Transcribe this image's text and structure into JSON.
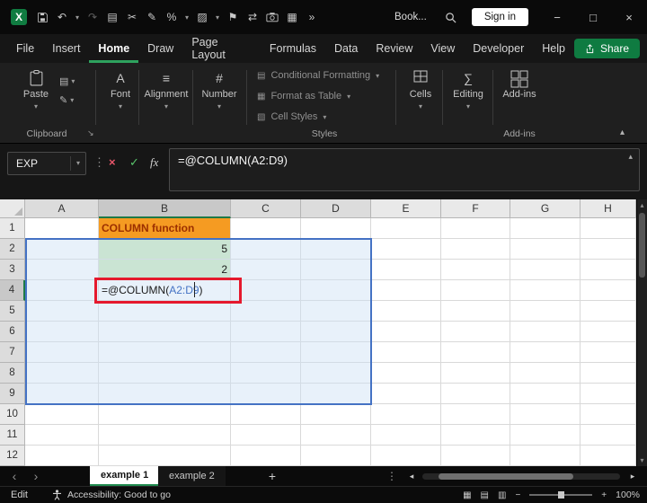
{
  "titlebar": {
    "workbook_name": "Book...",
    "sign_in_label": "Sign in"
  },
  "menubar": {
    "items": [
      "File",
      "Insert",
      "Home",
      "Draw",
      "Page Layout",
      "Formulas",
      "Data",
      "Review",
      "View",
      "Developer",
      "Help"
    ],
    "active_item": "Home",
    "share_label": "Share"
  },
  "ribbon": {
    "paste_label": "Paste",
    "clipboard_group_label": "Clipboard",
    "font_label": "Font",
    "alignment_label": "Alignment",
    "number_label": "Number",
    "conditional_formatting_label": "Conditional Formatting",
    "format_as_table_label": "Format as Table",
    "cell_styles_label": "Cell Styles",
    "styles_group_label": "Styles",
    "cells_label": "Cells",
    "editing_label": "Editing",
    "addins_label": "Add-ins",
    "addins_group_label": "Add-ins"
  },
  "formula_bar": {
    "name_box_value": "EXP",
    "fx_label": "fx",
    "formula": "=@COLUMN(A2:D9)"
  },
  "grid": {
    "column_headers": [
      "A",
      "B",
      "C",
      "D",
      "E",
      "F",
      "G",
      "H"
    ],
    "row_headers": [
      "1",
      "2",
      "3",
      "4",
      "5",
      "6",
      "7",
      "8",
      "9",
      "10",
      "11",
      "12"
    ],
    "selected_range": "A2:D9",
    "active_cell": "B4",
    "cells": {
      "B1": "COLUMN function",
      "B2": "5",
      "B3": "2",
      "B4_prefix": "=@COLUMN(",
      "B4_ref": "A2:D9",
      "B4_suffix": ")"
    }
  },
  "sheet_bar": {
    "tabs": [
      {
        "label": "example 1"
      },
      {
        "label": "example 2"
      }
    ]
  },
  "status_bar": {
    "mode_label": "Edit",
    "accessibility_label": "Accessibility: Good to go",
    "zoom_value": "100%"
  },
  "colors": {
    "excel_green": "#107c41",
    "share_button_green": "#0f7b41",
    "menu_underline_green": "#2ea25e",
    "reference_blue": "#4472c4",
    "annotation_red": "#e5192d",
    "cell_orange_fill": "#f59b22",
    "cell_orange_text": "#9c2f00",
    "cell_green_fill": "#c9e7b8",
    "cancel_red": "#e8566a",
    "enter_green": "#58c46b"
  },
  "icons": {
    "undo": "↶",
    "redo": "↷",
    "copy": "▤",
    "cut": "✂",
    "format_painter": "✎",
    "percent": "%",
    "fill_color": "▨",
    "flag": "⚑",
    "merge": "⇄",
    "borders": "▦",
    "more": "»",
    "chevron_down": "▾",
    "chevron_up": "▴",
    "dots": "⋮",
    "cancel": "×",
    "enter": "✓",
    "minimize": "−",
    "restore": "□",
    "close": "×",
    "font": "A",
    "alignment": "≡",
    "number": "#",
    "editing": "∑",
    "cond_format": "▤",
    "format_table": "▦",
    "cell_styles": "▧",
    "launcher": "↘",
    "add_sheet": "+",
    "nav_left": "‹",
    "nav_right": "›",
    "scroll_left": "◂",
    "scroll_right": "▸",
    "scroll_up": "▴",
    "scroll_down": "▾",
    "view_normal": "▦",
    "view_layout": "▤",
    "view_break": "▥",
    "zoom_out": "−",
    "zoom_in": "+"
  }
}
